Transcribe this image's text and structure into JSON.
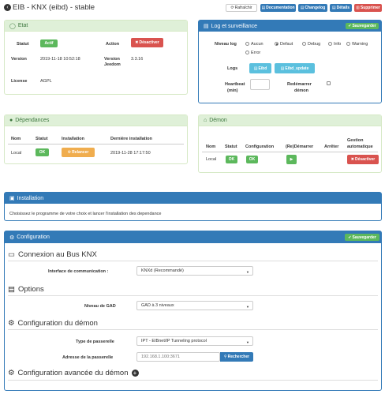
{
  "header": {
    "title": "EIB - KNX (eibd) - stable",
    "buttons": {
      "refresh": "Rafraîchir",
      "documentation": "Documentation",
      "changelog": "Changelog",
      "details": "Détails",
      "delete": "Supprimer"
    }
  },
  "etat": {
    "title": "Etat",
    "statut_label": "Statut",
    "statut_value": "Actif",
    "action_label": "Action",
    "action_button": "Désactiver",
    "version_label": "Version",
    "version_value": "2019-11-18 10:52:18",
    "jeedom_label_1": "Version",
    "jeedom_label_2": "Jeedom",
    "jeedom_value": "3.3.16",
    "license_label": "License",
    "license_value": "AGPL"
  },
  "log": {
    "title": "Log et surveillance",
    "save_button": "Sauvegarder",
    "level_label": "Niveau log",
    "levels": [
      "Aucun",
      "Defaut",
      "Debug",
      "Info",
      "Warning",
      "Error"
    ],
    "selected_level": "Defaut",
    "logs_label": "Logs",
    "log_buttons": [
      "Eibd",
      "Eibd_update"
    ],
    "heartbeat_label_1": "Heartbeat",
    "heartbeat_label_2": "(min)",
    "heartbeat_value": "",
    "restart_label_1": "Redémarrer",
    "restart_label_2": "démon"
  },
  "deps": {
    "title": "Dépendances",
    "columns": [
      "Nom",
      "Statut",
      "Installation",
      "Dernière installation"
    ],
    "row": {
      "name": "Local",
      "status": "OK",
      "install_button": "Relancer",
      "last": "2019-11-28 17:17:50"
    }
  },
  "demon": {
    "title": "Démon",
    "columns": [
      "Nom",
      "Statut",
      "Configuration",
      "(Re)Démarrer",
      "Arrêter",
      "Gestion",
      "automatique"
    ],
    "row": {
      "name": "Local",
      "status": "OK",
      "config": "OK",
      "disable_button": "Désactiver"
    }
  },
  "installation": {
    "title": "Installation",
    "text": "Choisissez le programme de votre choix et lancer l'installation des dependance"
  },
  "config": {
    "title": "Configuration",
    "save_button": "Sauvegarder",
    "bus_title": "Connexion au Bus KNX",
    "iface_label": "Interface de communication :",
    "iface_value": "KNXd (Recommandé)",
    "options_title": "Options",
    "gad_label": "Niveau de GAD",
    "gad_value": "GAD à 3 niveaux",
    "daemon_title": "Configuration du démon",
    "gateway_type_label": "Type de passerelle",
    "gateway_type_value": "IPT - EIBnet/IP Tunneling protocol",
    "gateway_addr_label": "Adresse de la passerelle",
    "gateway_addr_value": "192.168.1.100:3671",
    "search_button": "Rechercher",
    "advanced_title": "Configuration avancée du démon"
  },
  "colors": {
    "success": "#5cb85c",
    "danger": "#d9534f",
    "primary": "#337ab7",
    "info": "#5bc0de",
    "warning": "#f0ad4e",
    "panel_success_bg": "#dff0d8",
    "panel_success_border": "#d6e9c6",
    "panel_primary": "#337ab7"
  }
}
